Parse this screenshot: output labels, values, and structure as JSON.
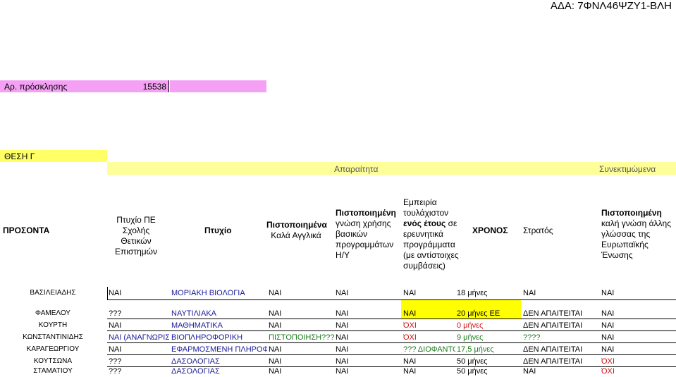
{
  "header": {
    "ada": "ΑΔΑ: 7ΦΝΛ46ΨΖΥ1-ΒΛΗ"
  },
  "call": {
    "label": "Αρ. πρόσκλησης",
    "number": "15538"
  },
  "position": {
    "label": "ΘΕΣΗ Γ"
  },
  "groups": {
    "required": "Απαραίτητα",
    "preferred": "Συνεκτιμώμενα"
  },
  "columns": {
    "candidates": "ΠΡΟΣΟΝΤΑ",
    "degree_pe": [
      "Πτυχίο ΠΕ",
      "Σχολής Θετικών",
      "Επιστημών"
    ],
    "degree": "Πτυχίο",
    "english": [
      "Πιστοποιημένα",
      "Καλά Αγγλικά"
    ],
    "computer": [
      "Πιστοποιημένη",
      "γνώση χρήσης",
      "βασικών",
      "προγραμμάτων",
      "Η/Υ"
    ],
    "experience": [
      "Εμπειρία",
      "τουλάχιστον",
      "ενός έτους σε",
      "ερευνητικά",
      "προγράμματα",
      "(με αντίστοιχες",
      "συμβάσεις)"
    ],
    "experience_bold": "ενός έτους",
    "experience_rest": " σε",
    "time": "ΧΡΟΝΟΣ",
    "military": "Στρατός",
    "other_lang": [
      "Πιστοποιημένη",
      "καλή γνώση άλλης",
      "γλώσσας της",
      "Ευρωπαϊκής",
      "Ένωσης"
    ]
  },
  "rows": [
    {
      "name": "ΒΑΣΙΛΕΙΑΔΗΣ",
      "pe": "ΝΑΙ",
      "degree": "ΜΟΡΙΑΚΗ ΒΙΟΛΟΓΙΑ",
      "english": "ΝΑΙ",
      "computer": "ΝΑΙ",
      "experience": "ΝΑΙ",
      "time": "18 μήνες",
      "military": "ΝΑΙ",
      "lang": "ΝΑΙ"
    },
    {
      "name": "ΦΑΜΕΛΟΥ",
      "pe": "???",
      "degree": "ΝΑΥΤΙΛΙΑΚΑ",
      "english": "ΝΑΙ",
      "computer": "ΝΑΙ",
      "experience": "ΝΑΙ",
      "time": "20 μήνες ΕΕ",
      "military": "ΔΕΝ ΑΠΑΙΤΕΙΤΑΙ",
      "lang": "ΝΑΙ"
    },
    {
      "name": "ΚΟΥΡΤΗ",
      "pe": "ΝΑΙ",
      "degree": "ΜΑΘΗΜΑΤΙΚΑ",
      "english": "ΝΑΙ",
      "computer": "ΝΑΙ",
      "experience": "ΌΧΙ",
      "time": "0 μήνες",
      "military": "ΔΕΝ ΑΠΑΙΤΕΙΤΑΙ",
      "lang": "ΝΑΙ"
    },
    {
      "name": "ΚΩΝΣΤΑΝΤΙΝΙΔΗΣ",
      "pe": "ΝΑΙ (ΑΝΑΓΝΩΡΙΣ",
      "degree": "ΒΙΟΠΛΗΡΟΦΟΡΙΚΗ",
      "english": "ΠΙΣΤΟΠΟΙΗΣΗ???",
      "computer": "ΝΑΙ",
      "experience": "ΌΧΙ",
      "time": "9 μήνες",
      "military": "????",
      "lang": "ΝΑΙ"
    },
    {
      "name": "ΚΑΡΑΓΕΩΡΓΙΟΥ",
      "pe": "ΝΑΙ",
      "degree": "ΕΦΑΡΜΟΣΜΕΝΗ ΠΛΗΡΟΦ",
      "english": "ΝΑΙ",
      "computer": "ΝΑΙ",
      "experience": "??? ΔΙΟΦΑΝΤΟ",
      "time": "17,5 μήνες",
      "military": "ΔΕΝ ΑΠΑΙΤΕΙΤΑΙ",
      "lang": "ΝΑΙ"
    },
    {
      "name": "ΚΟΥΤΣΩΝΑ",
      "pe": "???",
      "degree": "ΔΑΣΟΛΟΓΙΑΣ",
      "english": "ΝΑΙ",
      "computer": "ΝΑΙ",
      "experience": "ΝΑΙ",
      "time": "50 μήνες",
      "military": "ΔΕΝ ΑΠΑΙΤΕΙΤΑΙ",
      "lang": "ΌΧΙ"
    },
    {
      "name": "ΣΤΑΜΑΤΙΟΥ",
      "pe": "???",
      "degree": "ΔΑΣΟΛΟΓΙΑΣ",
      "english": "ΝΑΙ",
      "computer": "ΝΑΙ",
      "experience": "ΝΑΙ",
      "time": "50 μήνες",
      "military": "ΝΑΙ",
      "lang": "ΌΧΙ"
    }
  ],
  "colors": {
    "pink": "#f4a0f4",
    "yellow": "#ffff00",
    "light_yellow": "#ffff99",
    "blue_text": "#1a1a9a",
    "green_text": "#1a7a1a",
    "red_text": "#d01010"
  }
}
